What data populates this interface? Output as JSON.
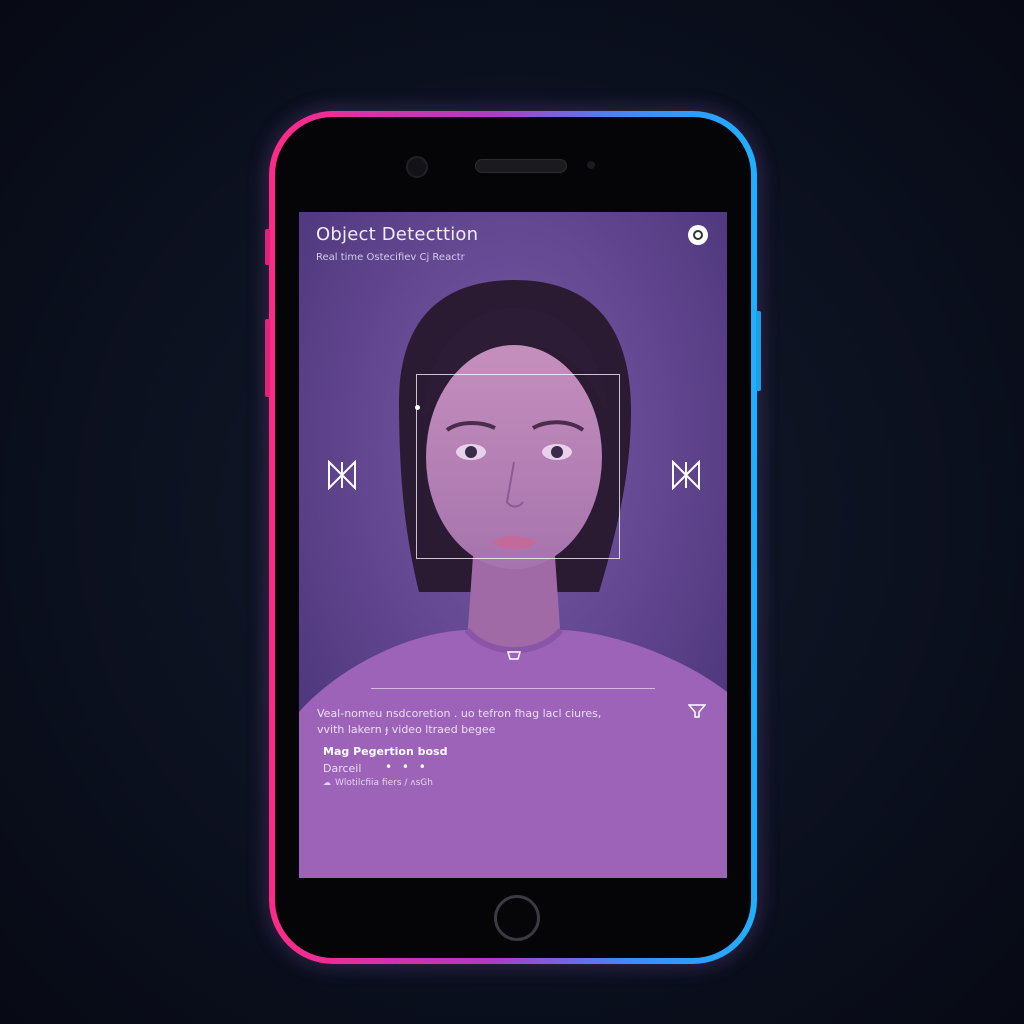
{
  "app": {
    "title": "Object Detecttion",
    "subtitle": "Real time Ostecifiev Cj Reactr"
  },
  "description": {
    "line1": "Veal-nomeu nsdcoretion . uo tefron fhag lacl ciures,",
    "line2": "vvith lakern ɟ video ltraed begee"
  },
  "info_card": {
    "title": "Mag Pegertion bosd",
    "status": "Darceil",
    "dots": "• • •",
    "meta": "Wlotilcfiia fiers / ʌsGh"
  },
  "icons": {
    "record": "record-icon",
    "prev": "bowtie-arrow-icon",
    "next": "bowtie-arrow-icon",
    "marker": "mouth-marker-icon",
    "side": "filter-icon"
  },
  "colors": {
    "frame_left": "#ff2a86",
    "frame_right": "#1fb0ff",
    "screen_tint": "#6a4a9c"
  }
}
